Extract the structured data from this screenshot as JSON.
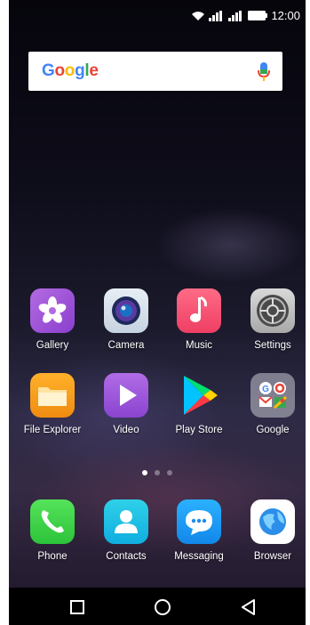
{
  "status_bar": {
    "time": "12:00"
  },
  "search": {
    "logo_text": "Google"
  },
  "apps_row1": [
    {
      "label": "Gallery",
      "icon": "gallery-icon"
    },
    {
      "label": "Camera",
      "icon": "camera-icon"
    },
    {
      "label": "Music",
      "icon": "music-icon"
    },
    {
      "label": "Settings",
      "icon": "settings-icon"
    }
  ],
  "apps_row2": [
    {
      "label": "File Explorer",
      "icon": "folder-icon"
    },
    {
      "label": "Video",
      "icon": "video-icon"
    },
    {
      "label": "Play Store",
      "icon": "play-store-icon"
    },
    {
      "label": "Google",
      "icon": "google-folder-icon"
    }
  ],
  "dock": [
    {
      "label": "Phone",
      "icon": "phone-icon"
    },
    {
      "label": "Contacts",
      "icon": "contacts-icon"
    },
    {
      "label": "Messaging",
      "icon": "messaging-icon"
    },
    {
      "label": "Browser",
      "icon": "browser-icon"
    }
  ],
  "page_indicator": {
    "pages": 3,
    "current": 1
  },
  "colors": {
    "google_blue": "#4285F4",
    "google_red": "#EA4335",
    "google_yellow": "#FBBC05",
    "google_green": "#34A853"
  }
}
